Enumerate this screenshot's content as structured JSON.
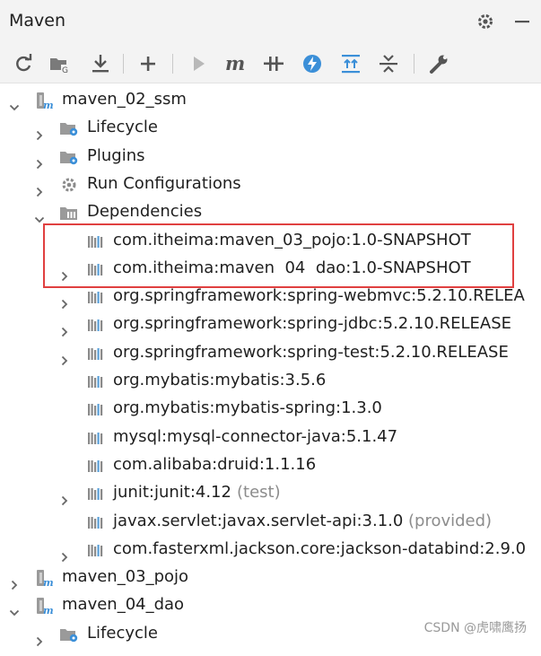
{
  "header": {
    "title": "Maven",
    "gear_icon": "gear-icon",
    "minimize_icon": "minimize-icon"
  },
  "toolbar": {
    "items": [
      {
        "name": "reload-icon"
      },
      {
        "name": "generate-sources-icon"
      },
      {
        "name": "download-icon"
      },
      {
        "name": "add-icon"
      },
      {
        "name": "run-icon"
      },
      {
        "name": "execute-goal-icon"
      },
      {
        "name": "toggle-offline-icon"
      },
      {
        "name": "skip-tests-icon"
      },
      {
        "name": "show-diagram-icon"
      },
      {
        "name": "collapse-all-icon"
      },
      {
        "name": "settings-wrench-icon"
      }
    ]
  },
  "tree": {
    "rows": [
      {
        "label": "maven_02_ssm",
        "suffix": "",
        "icon": "maven-module-icon",
        "arrow": "down",
        "level": 0
      },
      {
        "label": "Lifecycle",
        "suffix": "",
        "icon": "lifecycle-folder-icon",
        "arrow": "right",
        "level": 1
      },
      {
        "label": "Plugins",
        "suffix": "",
        "icon": "plugins-folder-icon",
        "arrow": "right",
        "level": 1
      },
      {
        "label": "Run Configurations",
        "suffix": "",
        "icon": "run-configurations-gear-icon",
        "arrow": "right",
        "level": 1
      },
      {
        "label": "Dependencies",
        "suffix": "",
        "icon": "dependencies-folder-icon",
        "arrow": "down",
        "level": 1
      },
      {
        "label": "com.itheima:maven_03_pojo:1.0-SNAPSHOT",
        "suffix": "",
        "icon": "library-icon",
        "arrow": "none",
        "level": 2
      },
      {
        "label": "com.itheima:maven  04  dao:1.0-SNAPSHOT",
        "suffix": "",
        "icon": "library-icon",
        "arrow": "right",
        "level": 2
      },
      {
        "label": "org.springframework:spring-webmvc:5.2.10.RELEA",
        "suffix": "",
        "icon": "library-icon",
        "arrow": "right",
        "level": 2
      },
      {
        "label": "org.springframework:spring-jdbc:5.2.10.RELEASE",
        "suffix": "",
        "icon": "library-icon",
        "arrow": "right",
        "level": 2
      },
      {
        "label": "org.springframework:spring-test:5.2.10.RELEASE",
        "suffix": "",
        "icon": "library-icon",
        "arrow": "right",
        "level": 2
      },
      {
        "label": "org.mybatis:mybatis:3.5.6",
        "suffix": "",
        "icon": "library-icon",
        "arrow": "none",
        "level": 2
      },
      {
        "label": "org.mybatis:mybatis-spring:1.3.0",
        "suffix": "",
        "icon": "library-icon",
        "arrow": "none",
        "level": 2
      },
      {
        "label": "mysql:mysql-connector-java:5.1.47",
        "suffix": "",
        "icon": "library-icon",
        "arrow": "none",
        "level": 2
      },
      {
        "label": "com.alibaba:druid:1.1.16",
        "suffix": "",
        "icon": "library-icon",
        "arrow": "none",
        "level": 2
      },
      {
        "label": "junit:junit:4.12",
        "suffix": "(test)",
        "icon": "library-icon",
        "arrow": "right",
        "level": 2
      },
      {
        "label": "javax.servlet:javax.servlet-api:3.1.0",
        "suffix": "(provided)",
        "icon": "library-icon",
        "arrow": "none",
        "level": 2
      },
      {
        "label": "com.fasterxml.jackson.core:jackson-databind:2.9.0",
        "suffix": "",
        "icon": "library-icon",
        "arrow": "right",
        "level": 2
      },
      {
        "label": "maven_03_pojo",
        "suffix": "",
        "icon": "maven-module-icon",
        "arrow": "right",
        "level": 0
      },
      {
        "label": "maven_04_dao",
        "suffix": "",
        "icon": "maven-module-icon",
        "arrow": "down",
        "level": 0
      },
      {
        "label": "Lifecycle",
        "suffix": "",
        "icon": "lifecycle-folder-icon",
        "arrow": "right",
        "level": 1
      }
    ]
  },
  "watermark": "CSDN @虎啸鹰扬",
  "colors": {
    "accent_blue": "#3b8fd8",
    "highlight_box": "#e04040",
    "panel_bg": "#f3f3f3"
  }
}
